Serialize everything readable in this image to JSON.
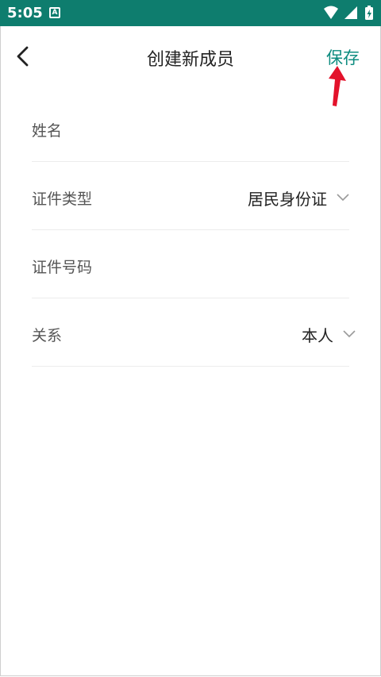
{
  "status": {
    "time": "5:05",
    "app_icon_letter": "A"
  },
  "header": {
    "title": "创建新成员",
    "save_label": "保存"
  },
  "form": {
    "fields": [
      {
        "label": "姓名",
        "value": ""
      },
      {
        "label": "证件类型",
        "value": "居民身份证"
      },
      {
        "label": "证件号码",
        "value": ""
      },
      {
        "label": "关系",
        "value": "本人"
      }
    ]
  },
  "colors": {
    "statusbar": "#0e7d6e",
    "accent": "#0e8c80",
    "annotation_arrow": "#e3122b"
  }
}
